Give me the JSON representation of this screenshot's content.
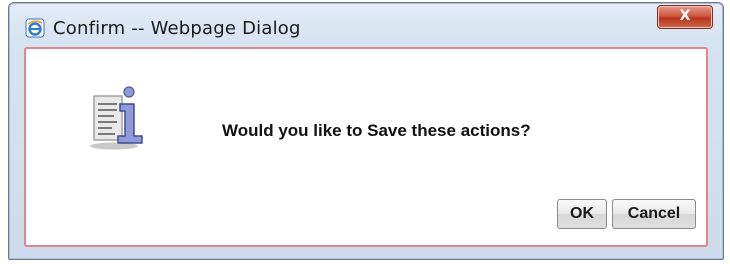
{
  "window": {
    "title": "Confirm -- Webpage Dialog",
    "title_icon": "ie-icon",
    "close_label": "X"
  },
  "dialog": {
    "icon": "info-document-icon",
    "message": "Would you like to Save these actions?",
    "buttons": {
      "ok_label": "OK",
      "cancel_label": "Cancel"
    }
  },
  "colors": {
    "client_border": "#e2848c",
    "close_button": "#c94a33",
    "titlebar": "#d6e3f2"
  }
}
